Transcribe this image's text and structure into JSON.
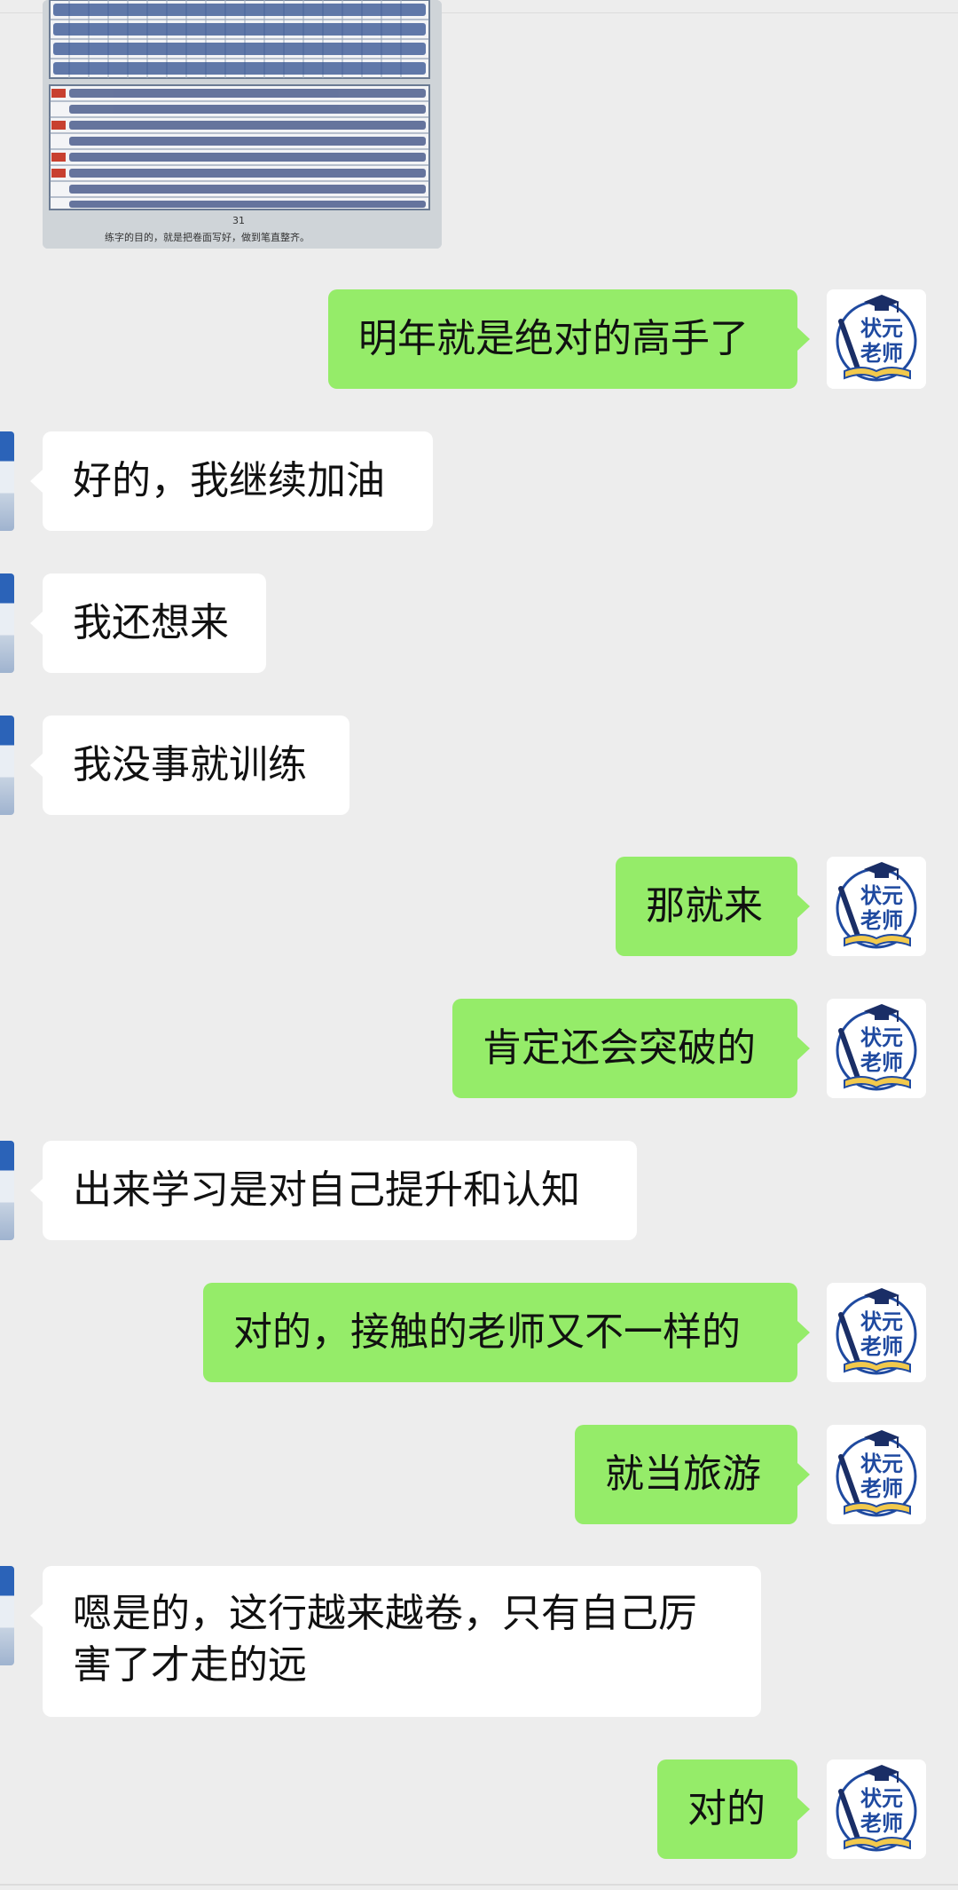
{
  "teacher_avatar": {
    "line1": "状元",
    "line2": "老师",
    "icon": "graduation-cap-book-pen-icon",
    "accent": "#1f4aa0"
  },
  "shared_image": {
    "page_number": "31",
    "caption": "练字的目的，就是把卷面写好，做到笔直整齐。"
  },
  "messages": [
    {
      "side": "right",
      "text": "明年就是绝对的高手了"
    },
    {
      "side": "left",
      "text": "好的，我继续加油"
    },
    {
      "side": "left",
      "text": "我还想来"
    },
    {
      "side": "left",
      "text": "我没事就训练"
    },
    {
      "side": "right",
      "text": "那就来"
    },
    {
      "side": "right",
      "text": "肯定还会突破的"
    },
    {
      "side": "left",
      "text": "出来学习是对自己提升和认知"
    },
    {
      "side": "right",
      "text": "对的，接触的老师又不一样的"
    },
    {
      "side": "right",
      "text": "就当旅游"
    },
    {
      "side": "left",
      "text": "嗯是的，这行越来越卷，只有自己厉害了才走的远"
    },
    {
      "side": "right",
      "text": "对的"
    }
  ],
  "colors": {
    "background": "#ededed",
    "bubble_self": "#95ec69",
    "bubble_other": "#ffffff"
  }
}
